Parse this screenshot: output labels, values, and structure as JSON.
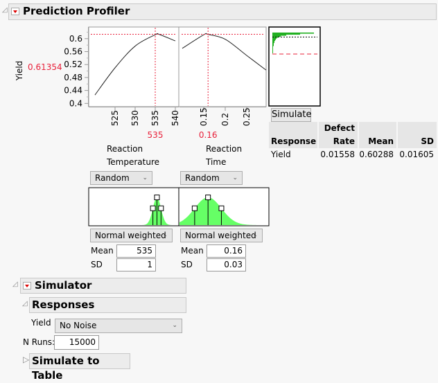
{
  "profiler": {
    "title": "Prediction Profiler",
    "response_label": "Yield",
    "response_value": "0.61354",
    "factors": [
      {
        "name_line1": "Reaction",
        "name_line2": "Temperature",
        "current": "535",
        "ticks": [
          "525",
          "530",
          "535",
          "540"
        ],
        "curve": {
          "x": [
            520,
            525,
            530,
            535,
            536,
            540
          ],
          "y": [
            0.426,
            0.51,
            0.577,
            0.612,
            0.613,
            0.593
          ]
        },
        "distribution": "Random",
        "dist_type": "Normal weighted",
        "mean_label": "Mean",
        "mean": "535",
        "sd_label": "SD",
        "sd": "1"
      },
      {
        "name_line1": "Reaction",
        "name_line2": "Time",
        "current": "0.16",
        "ticks": [
          "0.15",
          "0.2",
          "0.25"
        ],
        "curve": {
          "x": [
            0.1,
            0.15,
            0.16,
            0.2,
            0.25,
            0.295
          ],
          "y": [
            0.57,
            0.612,
            0.613,
            0.598,
            0.548,
            0.503
          ]
        },
        "distribution": "Random",
        "dist_type": "Normal weighted",
        "mean_label": "Mean",
        "mean": "0.16",
        "sd_label": "SD",
        "sd": "0.03"
      }
    ],
    "y_ticks": [
      "0.4",
      "0.44",
      "0.48",
      "0.52",
      "0.56",
      "0.6"
    ],
    "colors": {
      "current": "#e8203a",
      "hist": "#22b022",
      "dist": "#66ff66"
    },
    "simulate_label": "Simulate",
    "table": {
      "headers": [
        "Response",
        "Defect\nRate",
        "Mean",
        "SD"
      ],
      "header_defect_1": "Defect",
      "header_defect_2": "Rate",
      "rows": [
        {
          "response": "Yield",
          "defect_rate": "0.01558",
          "mean": "0.60288",
          "sd": "0.01605"
        }
      ]
    }
  },
  "simulator": {
    "title": "Simulator",
    "responses_title": "Responses",
    "yield_label": "Yield",
    "yield_noise": "No Noise",
    "n_runs_label": "N Runs:",
    "n_runs": "15000",
    "simulate_to_table": "Simulate to Table"
  }
}
